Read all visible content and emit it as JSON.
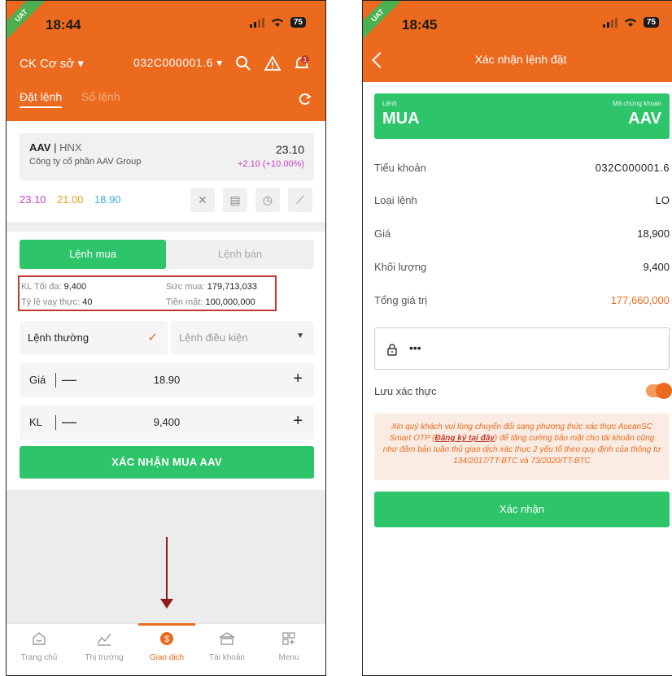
{
  "colors": {
    "brand": "#ec6a1e",
    "buy": "#2ec46a",
    "highlight": "#c0392b",
    "ceiling": "#c840c8",
    "reference": "#e8a317",
    "floor": "#3fa9f5"
  },
  "status": {
    "time_left": "18:44",
    "time_right": "18:45",
    "uat": "UAT",
    "battery": "75"
  },
  "left": {
    "market": "CK Cơ sở",
    "account": "032C000001.6",
    "notif_count": "1",
    "tabs": [
      {
        "label": "Đặt lệnh"
      },
      {
        "label": "Sổ lệnh"
      }
    ],
    "stock": {
      "code": "AAV",
      "exchange": "HNX",
      "name": "Công ty cổ phần AAV Group",
      "price": "23.10",
      "change": "+2.10 (+10.00%)"
    },
    "prices": {
      "ceiling": "23.10",
      "reference": "21.00",
      "floor": "18.90"
    },
    "side_tabs": {
      "buy": "Lệnh mua",
      "sell": "Lệnh bán"
    },
    "info": {
      "max_qty_label": "KL Tối đa:",
      "max_qty": "9,400",
      "buying_power_label": "Sức mua:",
      "buying_power": "179,713,033",
      "margin_label": "Tỷ lệ vay thực:",
      "margin": "40",
      "cash_label": "Tiền mặt:",
      "cash": "100,000,000"
    },
    "order_type": {
      "normal": "Lệnh thường",
      "conditional": "Lệnh điều kiện"
    },
    "price_label": "Giá",
    "price_value": "18.90",
    "qty_label": "KL",
    "qty_value": "9,400",
    "confirm_button": "XÁC NHẬN MUA AAV",
    "nav": [
      {
        "label": "Trang chủ",
        "icon": "home-icon"
      },
      {
        "label": "Thị trường",
        "icon": "market-icon"
      },
      {
        "label": "Giao dịch",
        "icon": "trade-icon"
      },
      {
        "label": "Tài khoản",
        "icon": "account-icon"
      },
      {
        "label": "Menu",
        "icon": "menu-icon"
      }
    ]
  },
  "right": {
    "title": "Xác nhận lệnh đặt",
    "order_label": "Lệnh",
    "order_value": "MUA",
    "symbol_label": "Mã chứng khoán",
    "symbol_value": "AAV",
    "details": [
      {
        "k": "Tiểu khoản",
        "v": "032C000001.6"
      },
      {
        "k": "Loại lệnh",
        "v": "LO"
      },
      {
        "k": "Giá",
        "v": "18,900"
      },
      {
        "k": "Khối lượng",
        "v": "9,400"
      },
      {
        "k": "Tổng giá trị",
        "v": "177,660,000"
      }
    ],
    "pin_mask": "•••",
    "save_auth": "Lưu xác thực",
    "notice_part1": "Xin quý khách vui lòng chuyển đổi sang phương thức xác thực AseanSC Smart OTP (",
    "notice_link": "Đăng ký tại đây",
    "notice_part2": ") để tăng cường bảo mật cho tài khoản cũng như đảm bảo tuân thủ giao dịch xác thực 2 yếu tố theo quy định của thông tư 134/2017/TT-BTC và 73/2020/TT-BTC",
    "confirm_button": "Xác nhận"
  }
}
